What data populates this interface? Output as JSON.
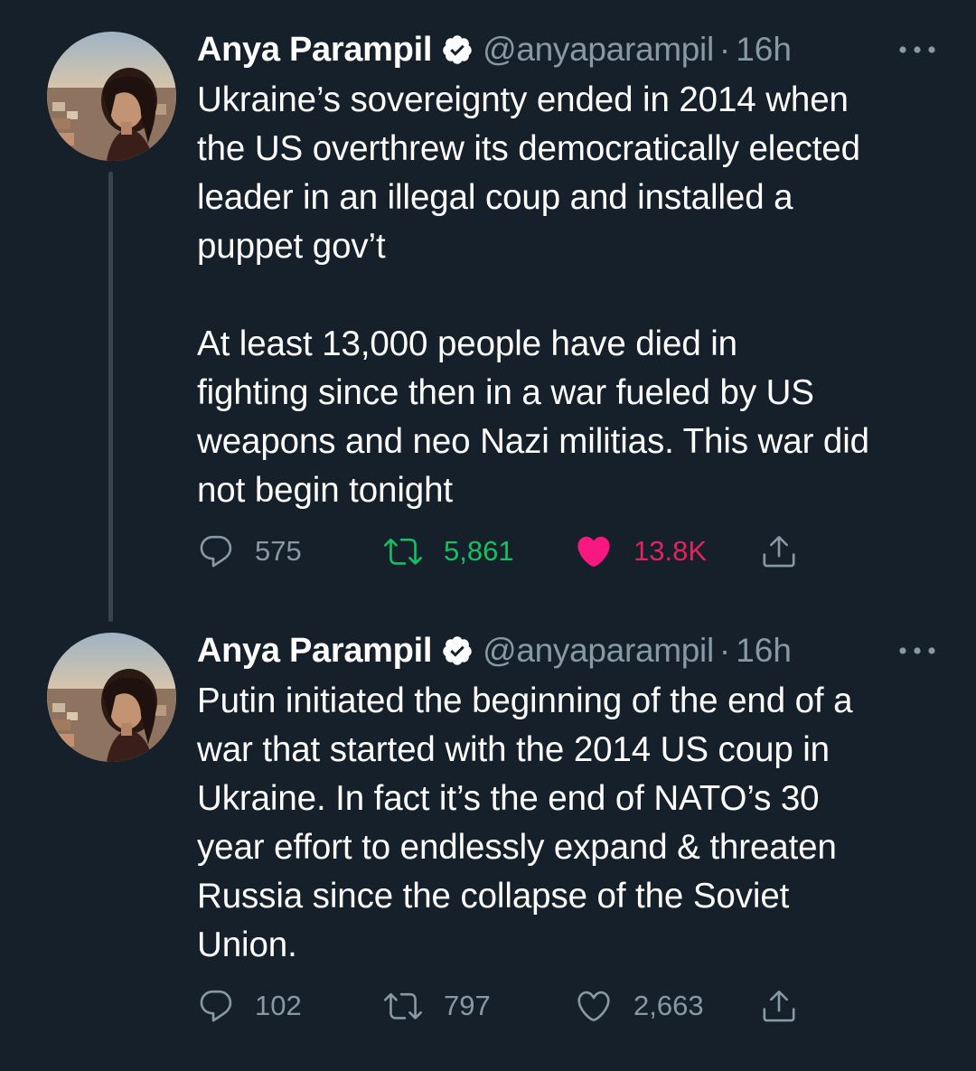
{
  "thread": [
    {
      "author": {
        "name": "Anya Parampil",
        "handle": "@anyaparampil",
        "verified": true,
        "avatar_icon": "profile-photo"
      },
      "separator": "·",
      "time": "16h",
      "text": "Ukraine’s sovereignty ended in 2014 when\nthe US overthrew its democratically elected\nleader in an illegal coup and installed a\npuppet gov’t\n\nAt least 13,000 people have died in\nfighting since then in a war fueled by US\nweapons and neo Nazi militias. This war did\nnot begin tonight",
      "stats": {
        "replies": "575",
        "retweets": "5,861",
        "likes": "13.8K"
      },
      "state": {
        "retweeted": true,
        "liked": true
      }
    },
    {
      "author": {
        "name": "Anya Parampil",
        "handle": "@anyaparampil",
        "verified": true,
        "avatar_icon": "profile-photo"
      },
      "separator": "·",
      "time": "16h",
      "text": "Putin initiated the beginning of the end of a\nwar that started with the 2014 US coup in\nUkraine. In fact it’s the end of NATO’s 30\nyear effort to endlessly expand & threaten\nRussia since the collapse of the Soviet\nUnion.",
      "stats": {
        "replies": "102",
        "retweets": "797",
        "likes": "2,663"
      },
      "state": {
        "retweeted": false,
        "liked": false
      }
    }
  ],
  "colors": {
    "background": "#15202b",
    "text_primary": "#ffffff",
    "text_secondary": "#8899a6",
    "retweet_green": "#17bf63",
    "like_pink": "#e0245e",
    "thread_line": "#38444d"
  },
  "icons": {
    "reply": "reply-icon",
    "retweet": "retweet-icon",
    "like": "heart-icon",
    "share": "share-icon",
    "more": "more-icon",
    "verified": "verified-badge-icon"
  }
}
